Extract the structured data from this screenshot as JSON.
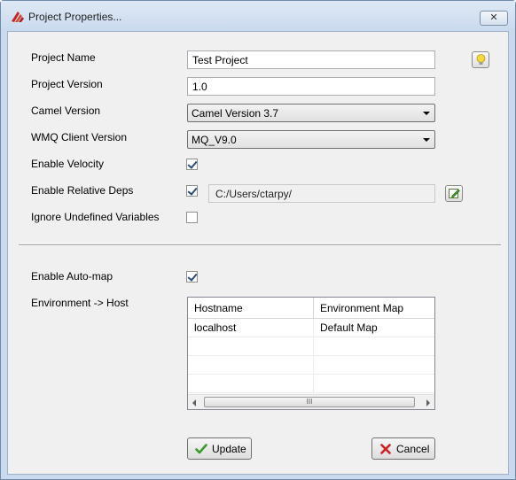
{
  "window": {
    "title": "Project Properties...",
    "close_glyph": "✕"
  },
  "form": {
    "project_name": {
      "label": "Project Name",
      "value": "Test Project"
    },
    "project_version": {
      "label": "Project Version",
      "value": "1.0"
    },
    "camel_version": {
      "label": "Camel Version",
      "value": "Camel Version 3.7"
    },
    "wmq_client_version": {
      "label": "WMQ Client Version",
      "value": "MQ_V9.0"
    },
    "enable_velocity": {
      "label": "Enable Velocity",
      "checked": true
    },
    "enable_relative_deps": {
      "label": "Enable Relative Deps",
      "checked": true,
      "path": "C:/Users/ctarpy/"
    },
    "ignore_undefined_variables": {
      "label": "Ignore Undefined Variables",
      "checked": false
    },
    "enable_auto_map": {
      "label": "Enable Auto-map",
      "checked": true
    },
    "environment_host": {
      "label": "Environment -> Host"
    }
  },
  "env_table": {
    "columns": [
      "Hostname",
      "Environment Map"
    ],
    "rows": [
      [
        "localhost",
        "Default Map"
      ]
    ],
    "scroll_grip": "III"
  },
  "buttons": {
    "update": "Update",
    "cancel": "Cancel"
  },
  "icons": {
    "lightbulb": "lightbulb-icon",
    "edit": "edit-icon",
    "update": "checkmark-icon",
    "cancel": "x-icon",
    "app": "app-icon"
  },
  "colors": {
    "window_frame": "#c9daee",
    "client_bg": "#f0f0f0",
    "check_green": "#3a9a2a",
    "cancel_red": "#cc2222",
    "bulb_yellow": "#f5d742"
  }
}
